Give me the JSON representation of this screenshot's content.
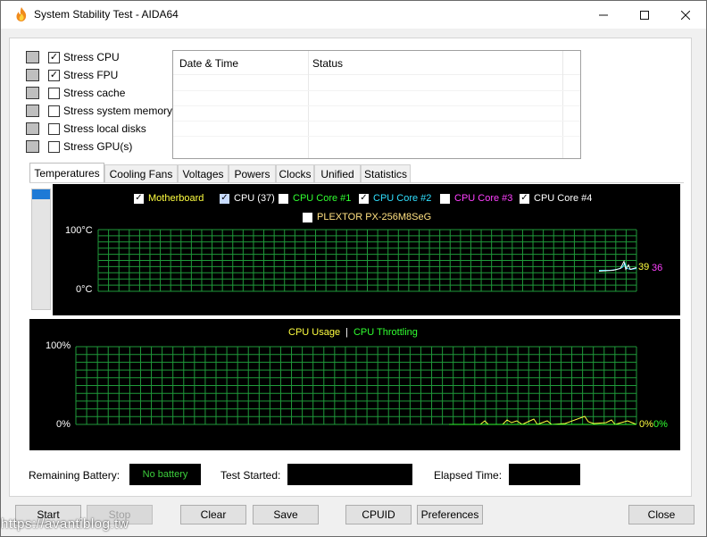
{
  "window": {
    "title": "System Stability Test - AIDA64"
  },
  "titlebar_buttons": {
    "minimize": "—",
    "maximize": "☐",
    "close": "✕"
  },
  "stress": [
    {
      "label": "Stress CPU",
      "checked": true,
      "icon": "cpu-chip-icon"
    },
    {
      "label": "Stress FPU",
      "checked": true,
      "icon": "percent-calc-icon"
    },
    {
      "label": "Stress cache",
      "checked": false,
      "icon": "cache-chip-icon"
    },
    {
      "label": "Stress system memory",
      "checked": false,
      "icon": "memory-module-icon"
    },
    {
      "label": "Stress local disks",
      "checked": false,
      "icon": "disk-drive-icon"
    },
    {
      "label": "Stress GPU(s)",
      "checked": false,
      "icon": "monitor-gpu-icon"
    }
  ],
  "log": {
    "col_date": "Date & Time",
    "col_status": "Status"
  },
  "tabs": [
    "Temperatures",
    "Cooling Fans",
    "Voltages",
    "Powers",
    "Clocks",
    "Unified",
    "Statistics"
  ],
  "active_tab": "Temperatures",
  "temp_graph": {
    "legend": [
      {
        "label": "Motherboard",
        "checked": true,
        "color": "#ffff40"
      },
      {
        "label": "CPU (37)",
        "checked": true,
        "color": "#ffffff"
      },
      {
        "label": "CPU Core #1",
        "checked": false,
        "color": "#30ff30"
      },
      {
        "label": "CPU Core #2",
        "checked": true,
        "color": "#30e0ff"
      },
      {
        "label": "CPU Core #3",
        "checked": false,
        "color": "#ff40ff"
      },
      {
        "label": "CPU Core #4",
        "checked": true,
        "color": "#ffffff"
      },
      {
        "label": "PLEXTOR PX-256M8SeG",
        "checked": false,
        "color": "#ffe080"
      }
    ],
    "y_max_label": "100°C",
    "y_min_label": "0°C",
    "current_values": {
      "a": "39",
      "b": "36"
    },
    "grid_color": "#1f9a3a"
  },
  "usage_graph": {
    "legend_usage": "CPU Usage",
    "legend_sep": "|",
    "legend_throttling": "CPU Throttling",
    "usage_color": "#ffff40",
    "throttling_color": "#30ff30",
    "y_max_label": "100%",
    "y_min_label": "0%",
    "current_usage": "0%",
    "current_throttling": "0%"
  },
  "status": {
    "battery_label": "Remaining Battery:",
    "battery_value": "No battery",
    "started_label": "Test Started:",
    "started_value": "",
    "elapsed_label": "Elapsed Time:",
    "elapsed_value": ""
  },
  "buttons": {
    "start": "Start",
    "stop": "Stop",
    "clear": "Clear",
    "save": "Save",
    "cpuid": "CPUID",
    "preferences": "Preferences",
    "close": "Close"
  },
  "watermark": "https://avantiblog.tw"
}
